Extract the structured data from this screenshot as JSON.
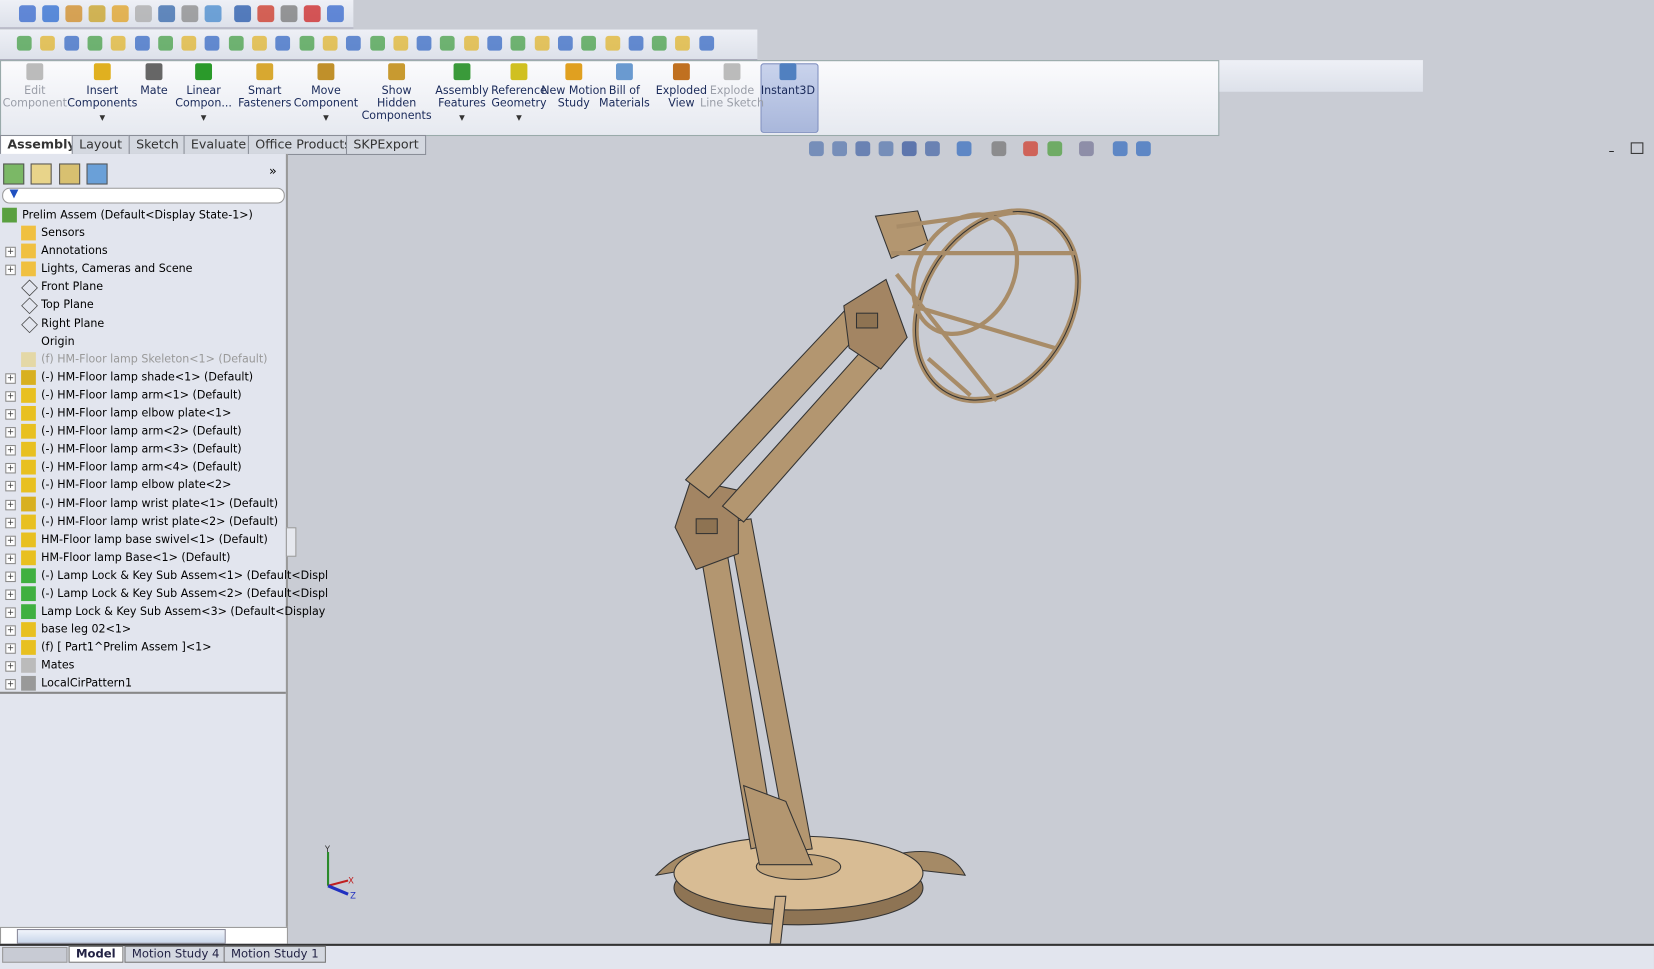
{
  "ribbon": {
    "commands": [
      {
        "label": "Edit Component",
        "disabled": true
      },
      {
        "label": "Insert Components",
        "dropdown": true
      },
      {
        "label": "Mate"
      },
      {
        "label": "Linear Compon...",
        "dropdown": true
      },
      {
        "label": "Smart Fasteners"
      },
      {
        "label": "Move Component",
        "dropdown": true
      },
      {
        "label": "Show Hidden Components"
      },
      {
        "label": "Assembly Features",
        "dropdown": true
      },
      {
        "label": "Reference Geometry",
        "dropdown": true
      },
      {
        "label": "New Motion Study"
      },
      {
        "label": "Bill of Materials"
      },
      {
        "label": "Exploded View"
      },
      {
        "label": "Explode Line Sketch",
        "disabled": true
      },
      {
        "label": "Instant3D",
        "active": true
      }
    ],
    "tabs": [
      "Assembly",
      "Layout",
      "Sketch",
      "Evaluate",
      "Office Products",
      "SKPExport"
    ],
    "active_tab": "Assembly"
  },
  "tree": {
    "root": "Prelim Assem  (Default<Display State-1>)",
    "items": [
      {
        "label": "Sensors",
        "icon": "sensor-folder-icon",
        "expand": false
      },
      {
        "label": "Annotations",
        "icon": "annotations-folder-icon",
        "expand": true
      },
      {
        "label": "Lights, Cameras and Scene",
        "icon": "lights-folder-icon",
        "expand": true
      },
      {
        "label": "Front Plane",
        "icon": "plane-icon",
        "expand": false
      },
      {
        "label": "Top Plane",
        "icon": "plane-icon",
        "expand": false
      },
      {
        "label": "Right Plane",
        "icon": "plane-icon",
        "expand": false
      },
      {
        "label": "Origin",
        "icon": "origin-icon",
        "expand": false
      },
      {
        "label": "(f) HM-Floor lamp Skeleton<1> (Default)",
        "icon": "part-icon",
        "expand": false,
        "dim": true
      },
      {
        "label": "(-) HM-Floor lamp shade<1> (Default)",
        "icon": "subassembly-icon",
        "expand": true
      },
      {
        "label": "(-) HM-Floor lamp arm<1> (Default)",
        "icon": "part-icon",
        "expand": true
      },
      {
        "label": "(-) HM-Floor lamp elbow plate<1>",
        "icon": "part-icon",
        "expand": true
      },
      {
        "label": "(-) HM-Floor lamp arm<2> (Default)",
        "icon": "part-icon",
        "expand": true
      },
      {
        "label": "(-) HM-Floor lamp arm<3> (Default)",
        "icon": "part-icon",
        "expand": true
      },
      {
        "label": "(-) HM-Floor lamp arm<4> (Default)",
        "icon": "part-icon",
        "expand": true
      },
      {
        "label": "(-) HM-Floor lamp elbow plate<2>",
        "icon": "part-icon",
        "expand": true
      },
      {
        "label": "(-) HM-Floor lamp wrist plate<1> (Default)",
        "icon": "subassembly-icon",
        "expand": true
      },
      {
        "label": "(-) HM-Floor lamp wrist plate<2> (Default)",
        "icon": "part-icon",
        "expand": true
      },
      {
        "label": "HM-Floor lamp base swivel<1> (Default)",
        "icon": "part-icon",
        "expand": true
      },
      {
        "label": "HM-Floor lamp Base<1> (Default)",
        "icon": "part-icon",
        "expand": true
      },
      {
        "label": "(-) Lamp Lock & Key Sub Assem<1> (Default<Displ",
        "icon": "green-assembly-icon",
        "expand": true
      },
      {
        "label": "(-) Lamp Lock & Key Sub Assem<2> (Default<Displ",
        "icon": "green-assembly-icon",
        "expand": true
      },
      {
        "label": "Lamp Lock & Key Sub Assem<3> (Default<Display",
        "icon": "green-assembly-icon",
        "expand": true
      },
      {
        "label": "base leg 02<1>",
        "icon": "part-icon",
        "expand": true
      },
      {
        "label": "(f) [ Part1^Prelim Assem ]<1>",
        "icon": "part-icon",
        "expand": true
      },
      {
        "label": "Mates",
        "icon": "mates-icon",
        "expand": true
      },
      {
        "label": "LocalCirPattern1",
        "icon": "pattern-icon",
        "expand": true
      }
    ]
  },
  "bottom_tabs": [
    "Model",
    "Motion Study 4",
    "Motion Study 1"
  ],
  "active_bottom_tab": "Model",
  "triad": {
    "x": "X",
    "y": "Y",
    "z": "Z"
  },
  "colors": {
    "viewport": "#c9ccd4",
    "wood": "#b89a72",
    "panel": "#e2e5ee"
  }
}
